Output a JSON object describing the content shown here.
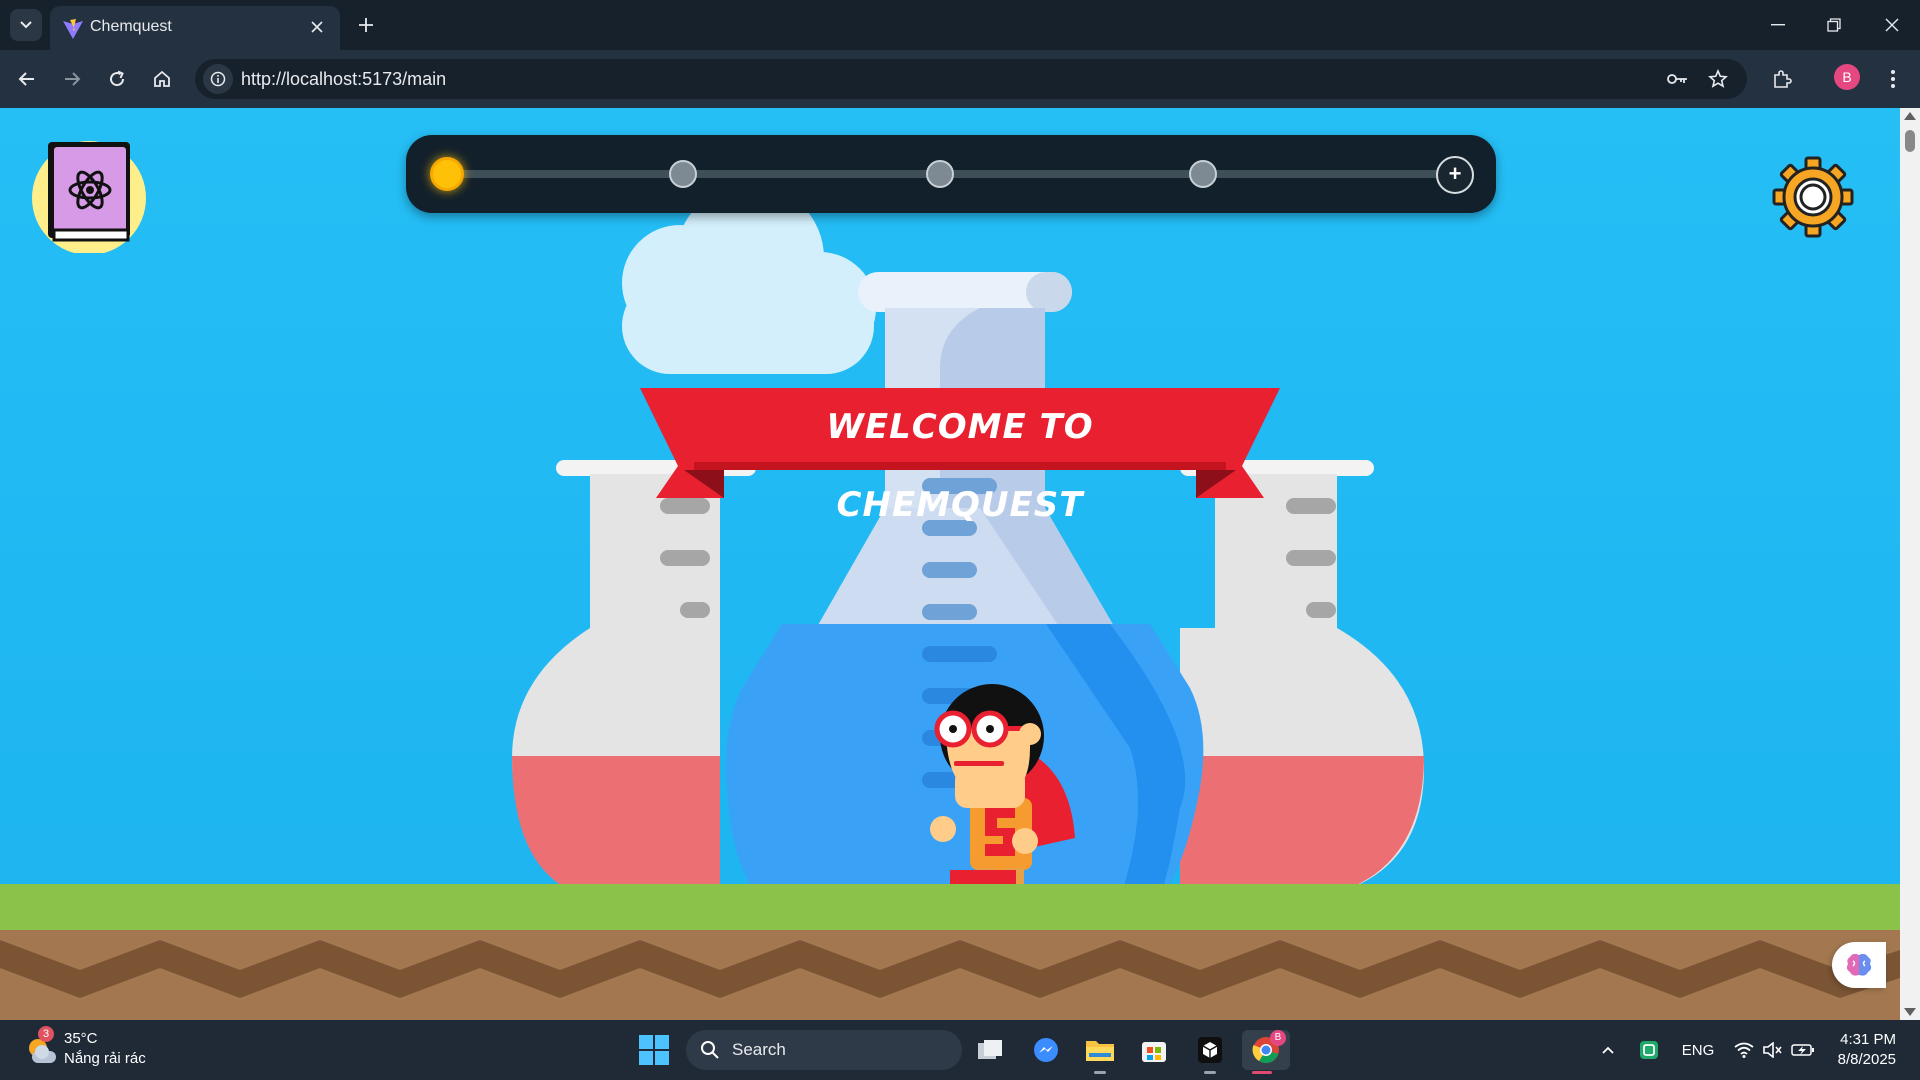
{
  "browser": {
    "tab": {
      "title": "Chemquest"
    },
    "url": "http://localhost:5173/main",
    "profile_initial": "B"
  },
  "game": {
    "banner_text": "WELCOME TO CHEMQUEST",
    "level_progress": {
      "total_nodes": 4,
      "current_level": 1,
      "add_symbol": "+"
    },
    "icons": [
      "chemistry-book-icon",
      "settings-gear-icon",
      "ai-brain-icon"
    ]
  },
  "taskbar": {
    "weather": {
      "temp": "35°C",
      "desc": "Nắng rải rác",
      "badge": "3"
    },
    "search_label": "Search",
    "chrome_badge": "B",
    "language": "ENG",
    "time": "4:31 PM",
    "date": "8/8/2025"
  },
  "colors": {
    "sky": "#25bef5",
    "banner_red": "#e8202f",
    "grass": "#8bc34a",
    "dirt": "#a37850",
    "current_level": "#ffc107"
  }
}
